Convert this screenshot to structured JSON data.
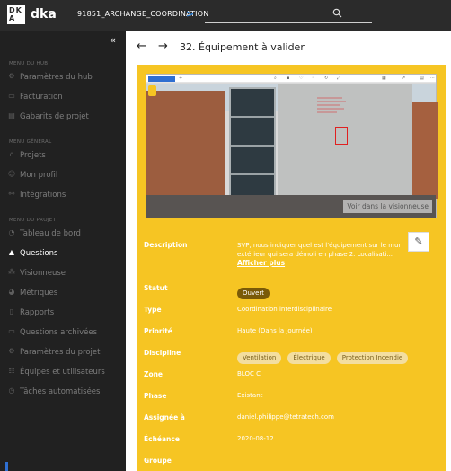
{
  "topbar": {
    "logo_top": "DK",
    "logo_bottom": "A",
    "brand": "dka",
    "project": "91851_ARCHANGE_COORDINATION",
    "project_chevron": ">",
    "search_icon": "search-icon"
  },
  "sidebar": {
    "collapse_icon": "«",
    "section_hub": "MENU DU HUB",
    "section_general": "MENU GÉNÉRAL",
    "section_project": "MENU DU PROJET",
    "items": [
      {
        "label": "Paramètres du hub",
        "icon": "⚙"
      },
      {
        "label": "Facturation",
        "icon": "▭"
      },
      {
        "label": "Gabarits de projet",
        "icon": "▤"
      },
      {
        "label": "Projets",
        "icon": "⌂"
      },
      {
        "label": "Mon profil",
        "icon": "☺"
      },
      {
        "label": "Intégrations",
        "icon": "⚯"
      },
      {
        "label": "Tableau de bord",
        "icon": "◔"
      },
      {
        "label": "Questions",
        "icon": "▲"
      },
      {
        "label": "Visionneuse",
        "icon": "⁂"
      },
      {
        "label": "Métriques",
        "icon": "◕"
      },
      {
        "label": "Rapports",
        "icon": "▯"
      },
      {
        "label": "Questions archivées",
        "icon": "▭"
      },
      {
        "label": "Paramètres du projet",
        "icon": "⚙"
      },
      {
        "label": "Équipes et utilisateurs",
        "icon": "☷"
      },
      {
        "label": "Tâches automatisées",
        "icon": "◷"
      }
    ]
  },
  "header": {
    "back_icon": "←",
    "forward_icon": "→",
    "title": "32. Équipement à valider"
  },
  "viewer": {
    "view_button": "Voir dans la visionneuse"
  },
  "details": {
    "description_label": "Description",
    "description_value": "SVP, nous indiquer quel est l'équipement sur le mur extérieur qui sera démoli en phase 2. Localisati...",
    "more_link": "Afficher plus",
    "edit_icon": "✎",
    "status_label": "Statut",
    "status_value": "Ouvert",
    "type_label": "Type",
    "type_value": "Coordination interdisciplinaire",
    "priority_label": "Priorité",
    "priority_value": "Haute (Dans la journée)",
    "discipline_label": "Discipline",
    "disciplines": [
      "Ventilation",
      "Électrique",
      "Protection Incendie"
    ],
    "zone_label": "Zone",
    "zone_value": "BLOC C",
    "phase_label": "Phase",
    "phase_value": "Existant",
    "assignee_label": "Assignée à",
    "assignee_value": "daniel.philippe@tetratech.com",
    "due_label": "Échéance",
    "due_value": "2020-08-12",
    "group_label": "Groupe",
    "group_value": ""
  },
  "colors": {
    "accent_yellow": "#f6c523",
    "sidebar_bg": "#212121",
    "topbar_bg": "#2b2b2b",
    "status_pill": "#7a5a08"
  }
}
